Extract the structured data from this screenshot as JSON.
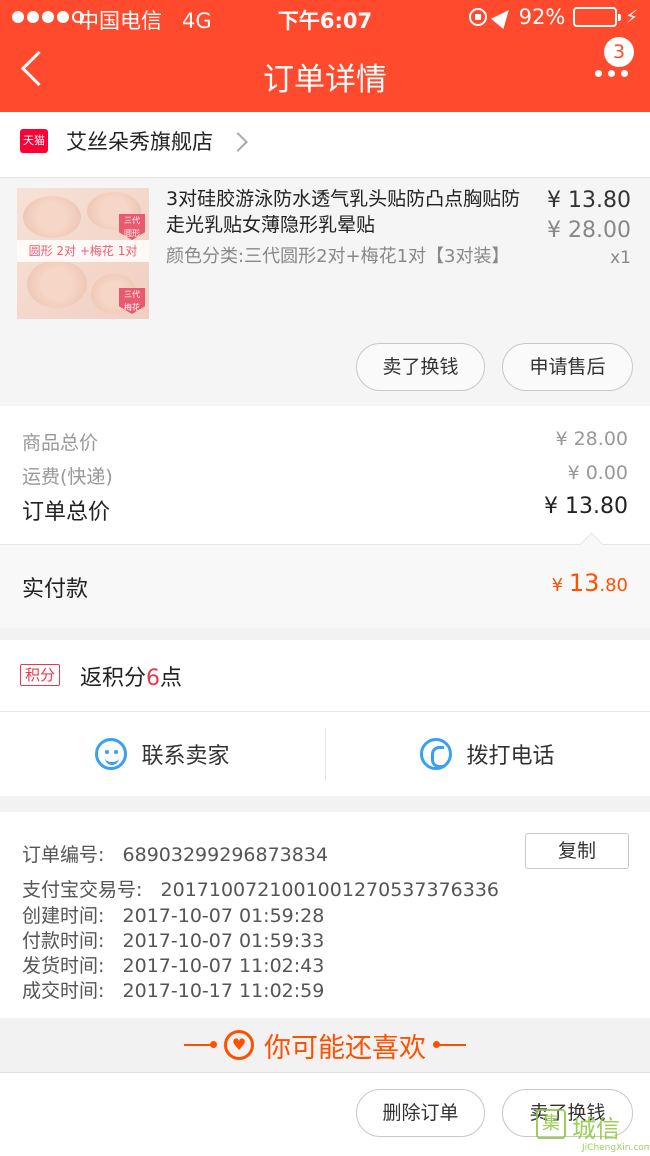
{
  "status_bar": {
    "carrier": "中国电信",
    "network": "4G",
    "time": "下午6:07",
    "battery": "92%"
  },
  "nav": {
    "title": "订单详情",
    "badge": "3"
  },
  "shop": {
    "badge": "天猫",
    "name": "艾丝朵秀旗舰店"
  },
  "product": {
    "title": "3对硅胶游泳防水透气乳头贴防凸点胸贴防走光乳贴女薄隐形乳晕贴",
    "spec": "颜色分类:三代圆形2对+梅花1对【3对装】",
    "price": "¥ 13.80",
    "original_price": "¥ 28.00",
    "quantity": "x1",
    "image_band": "圆形 2对 +梅花 1对",
    "image_tag": "三代",
    "image_tag_sub": "梅花",
    "image_tag_top_sub": "圆形",
    "buttons": {
      "sell": "卖了换钱",
      "after_sale": "申请售后"
    }
  },
  "totals": {
    "items_label": "商品总价",
    "items_value": "¥ 28.00",
    "shipping_label": "运费(快递)",
    "shipping_value": "¥ 0.00",
    "order_total_label": "订单总价",
    "order_total_value": "¥ 13.80",
    "paid_label": "实付款",
    "paid_currency": "¥",
    "paid_int": "13",
    "paid_dec": ".80"
  },
  "points": {
    "tag": "积分",
    "prefix": "返积分",
    "value": "6",
    "suffix": "点"
  },
  "contact": {
    "seller": "联系卖家",
    "call": "拨打电话"
  },
  "order_info": {
    "order_no_label": "订单编号:",
    "order_no": "68903299296873834",
    "copy": "复制",
    "alipay_label": "支付宝交易号:",
    "alipay_no": "2017100721001001270537376336",
    "created_label": "创建时间:",
    "created": "2017-10-07 01:59:28",
    "paid_label": "付款时间:",
    "paid": "2017-10-07 01:59:33",
    "shipped_label": "发货时间:",
    "shipped": "2017-10-07 11:02:43",
    "completed_label": "成交时间:",
    "completed": "2017-10-17 11:02:59"
  },
  "recommend": {
    "title": "你可能还喜欢"
  },
  "bottom": {
    "delete": "删除订单",
    "sell": "卖了换钱"
  },
  "watermark": {
    "text": "城信",
    "sub": "JiChengXin.com"
  },
  "colors": {
    "brand": "#ff4a2e",
    "accent": "#ff5000",
    "link_blue": "#3a9ff5"
  }
}
